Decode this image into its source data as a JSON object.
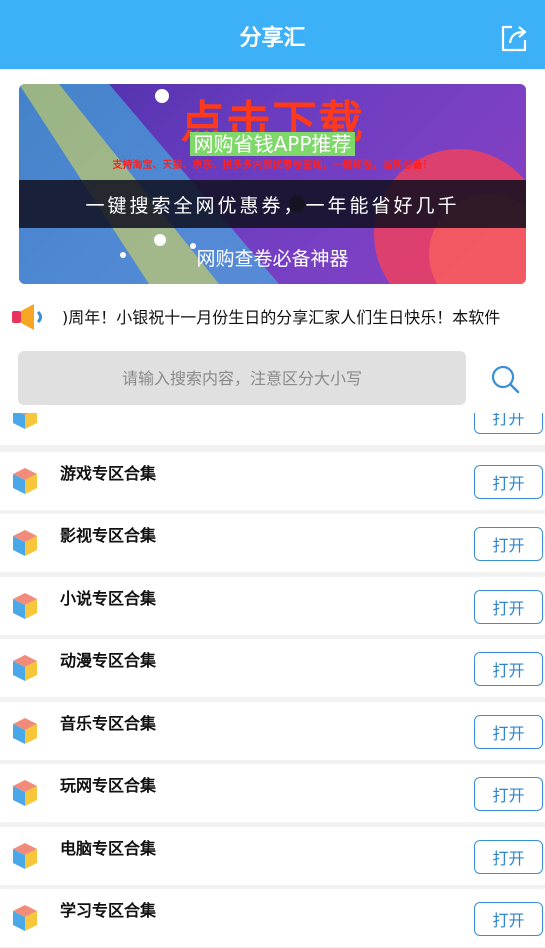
{
  "header": {
    "title": "分享汇",
    "share_icon": "share-icon"
  },
  "banner": {
    "headline": "点击下载",
    "subtitle": "网购省钱APP推荐",
    "fine_print": "支持淘宝、天猫、京东、拼多多内部优惠卷查询，一键领卷，省钱必备！",
    "slogan": "一键搜索全网优惠券，一年能省好几千",
    "tagline": "网购查卷必备神器"
  },
  "notice": {
    "icon": "speaker-icon",
    "text": ")周年！小银祝十一月份生日的分享汇家人们生日快乐！本软件"
  },
  "search": {
    "placeholder": "请输入搜索内容，注意区分大小写",
    "icon": "search-icon"
  },
  "list": {
    "open_label": "打开",
    "partial_open_label": "打开",
    "items": [
      {
        "name": "游戏专区合集"
      },
      {
        "name": "影视专区合集"
      },
      {
        "name": "小说专区合集"
      },
      {
        "name": "动漫专区合集"
      },
      {
        "name": "音乐专区合集"
      },
      {
        "name": "玩网专区合集"
      },
      {
        "name": "电脑专区合集"
      },
      {
        "name": "学习专区合集"
      }
    ]
  },
  "colors": {
    "accent": "#3db1f7",
    "button_border": "#3a8fd6"
  }
}
